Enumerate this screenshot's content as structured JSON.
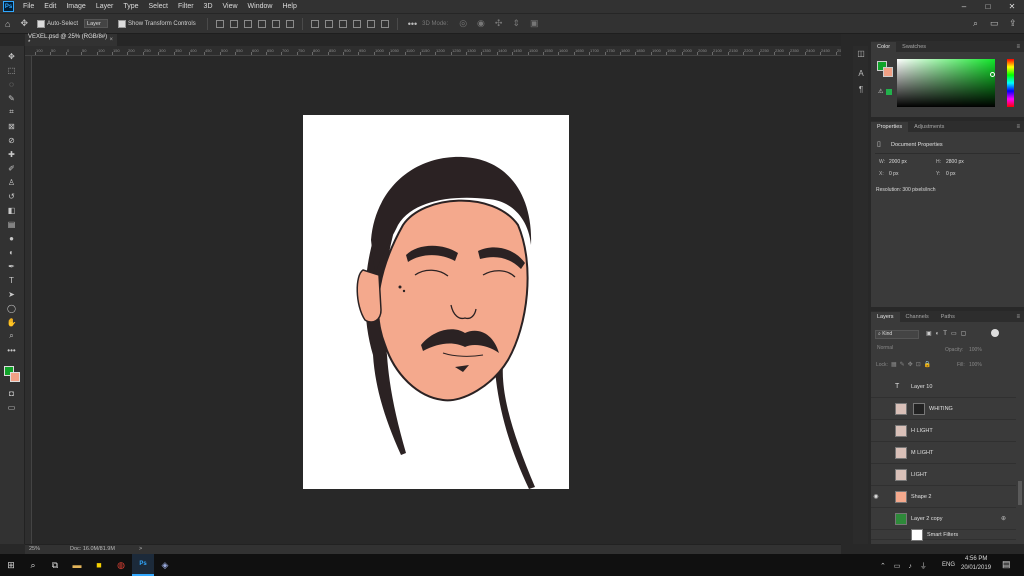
{
  "menu": [
    "File",
    "Edit",
    "Image",
    "Layer",
    "Type",
    "Select",
    "Filter",
    "3D",
    "View",
    "Window",
    "Help"
  ],
  "window_controls": [
    "–",
    "□",
    "✕"
  ],
  "options": {
    "auto_select_label": "Auto-Select",
    "auto_select_value": "Layer",
    "show_transform_label": "Show Transform Controls",
    "mode_3d_label": "3D Mode:"
  },
  "document_tab": {
    "title": "VEXEL.psd @ 25% (RGB/8#) *",
    "close": "×"
  },
  "ruler_labels": [
    "100",
    "50",
    "0",
    "50",
    "100",
    "150",
    "200",
    "250",
    "300",
    "350",
    "400",
    "450",
    "500",
    "550",
    "600",
    "650",
    "700",
    "750",
    "800",
    "850",
    "900",
    "950",
    "1000",
    "1050",
    "1100",
    "1150",
    "1200",
    "1250",
    "1300",
    "1350",
    "1400",
    "1450",
    "1500",
    "1550",
    "1600",
    "1650",
    "1700",
    "1750",
    "1800",
    "1850",
    "1900",
    "1950",
    "2000",
    "2050",
    "2100",
    "2150",
    "2200",
    "2250",
    "2300",
    "2350",
    "2400",
    "2450",
    "2500"
  ],
  "status": {
    "zoom": "25%",
    "doc": "Doc: 16.0M/81.9M",
    "arrow": ">"
  },
  "color_panel": {
    "tabs": [
      "Color",
      "Swatches"
    ],
    "accent": "#11a32a"
  },
  "properties_panel": {
    "tabs": [
      "Properties",
      "Adjustments"
    ],
    "section": "Document Properties",
    "w_label": "W:",
    "w_value": "2000 px",
    "h_label": "H:",
    "h_value": "2800 px",
    "x_label": "X:",
    "x_value": "0 px",
    "y_label": "Y:",
    "y_value": "0 px",
    "resolution": "Resolution: 300 pixels/inch"
  },
  "layers_panel": {
    "tabs": [
      "Layers",
      "Channels",
      "Paths"
    ],
    "kind": "Kind",
    "blend": "Normal",
    "opacity_label": "Opacity:",
    "opacity_value": "100%",
    "lock_label": "Lock:",
    "fill_label": "Fill:",
    "fill_value": "100%",
    "layers": [
      {
        "name": "Layer 10",
        "visible": false
      },
      {
        "name": "WHITING",
        "visible": false
      },
      {
        "name": "H LIGHT",
        "visible": false
      },
      {
        "name": "M LIGHT",
        "visible": false
      },
      {
        "name": "LIGHT",
        "visible": false
      },
      {
        "name": "Shape 2",
        "visible": true
      },
      {
        "name": "Layer 2 copy",
        "visible": false
      },
      {
        "name": "Smart Filters",
        "visible": false
      }
    ]
  },
  "taskbar": {
    "language": "ENG",
    "time": "4:56 PM",
    "date": "20/01/2019"
  }
}
